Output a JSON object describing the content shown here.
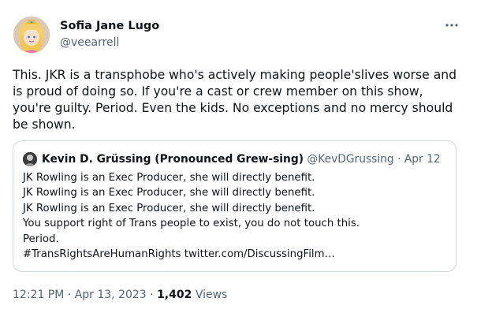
{
  "tweet": {
    "author": {
      "name": "Sofia Jane Lugo",
      "handle": "@veearrell",
      "avatar_icon": "avatar-princess-icon"
    },
    "more_icon": "more-options-icon",
    "text": "This. JKR is a transphobe who's actively making people'slives worse and is proud of doing so. If you're a cast or crew member on this show, you're guilty. Period. Even the kids. No exceptions and no mercy should be shown.",
    "quote": {
      "author": {
        "name": "Kevin D. Grüssing (Pronounced Grew-sing)",
        "handle": "@KevDGrussing",
        "separator": "·",
        "date": "Apr 12",
        "avatar_icon": "avatar-icon"
      },
      "lines": [
        "JK Rowling is an Exec Producer, she will directly benefit.",
        "JK Rowling is an Exec Producer, she will directly benefit.",
        "JK Rowling is an Exec Producer, she will directly benefit.",
        "You support right of Trans people to exist, you do not touch this.",
        "Period.",
        "#TransRightsAreHumanRights twitter.com/DiscussingFilm…"
      ]
    },
    "meta": {
      "time": "12:21 PM",
      "sep1": "·",
      "date": "Apr 13, 2023",
      "sep2": "·",
      "views": "1,402",
      "views_label": "Views"
    }
  },
  "colors": {
    "text": "#0f1419",
    "secondary": "#536471",
    "border": "#cfd9de"
  }
}
